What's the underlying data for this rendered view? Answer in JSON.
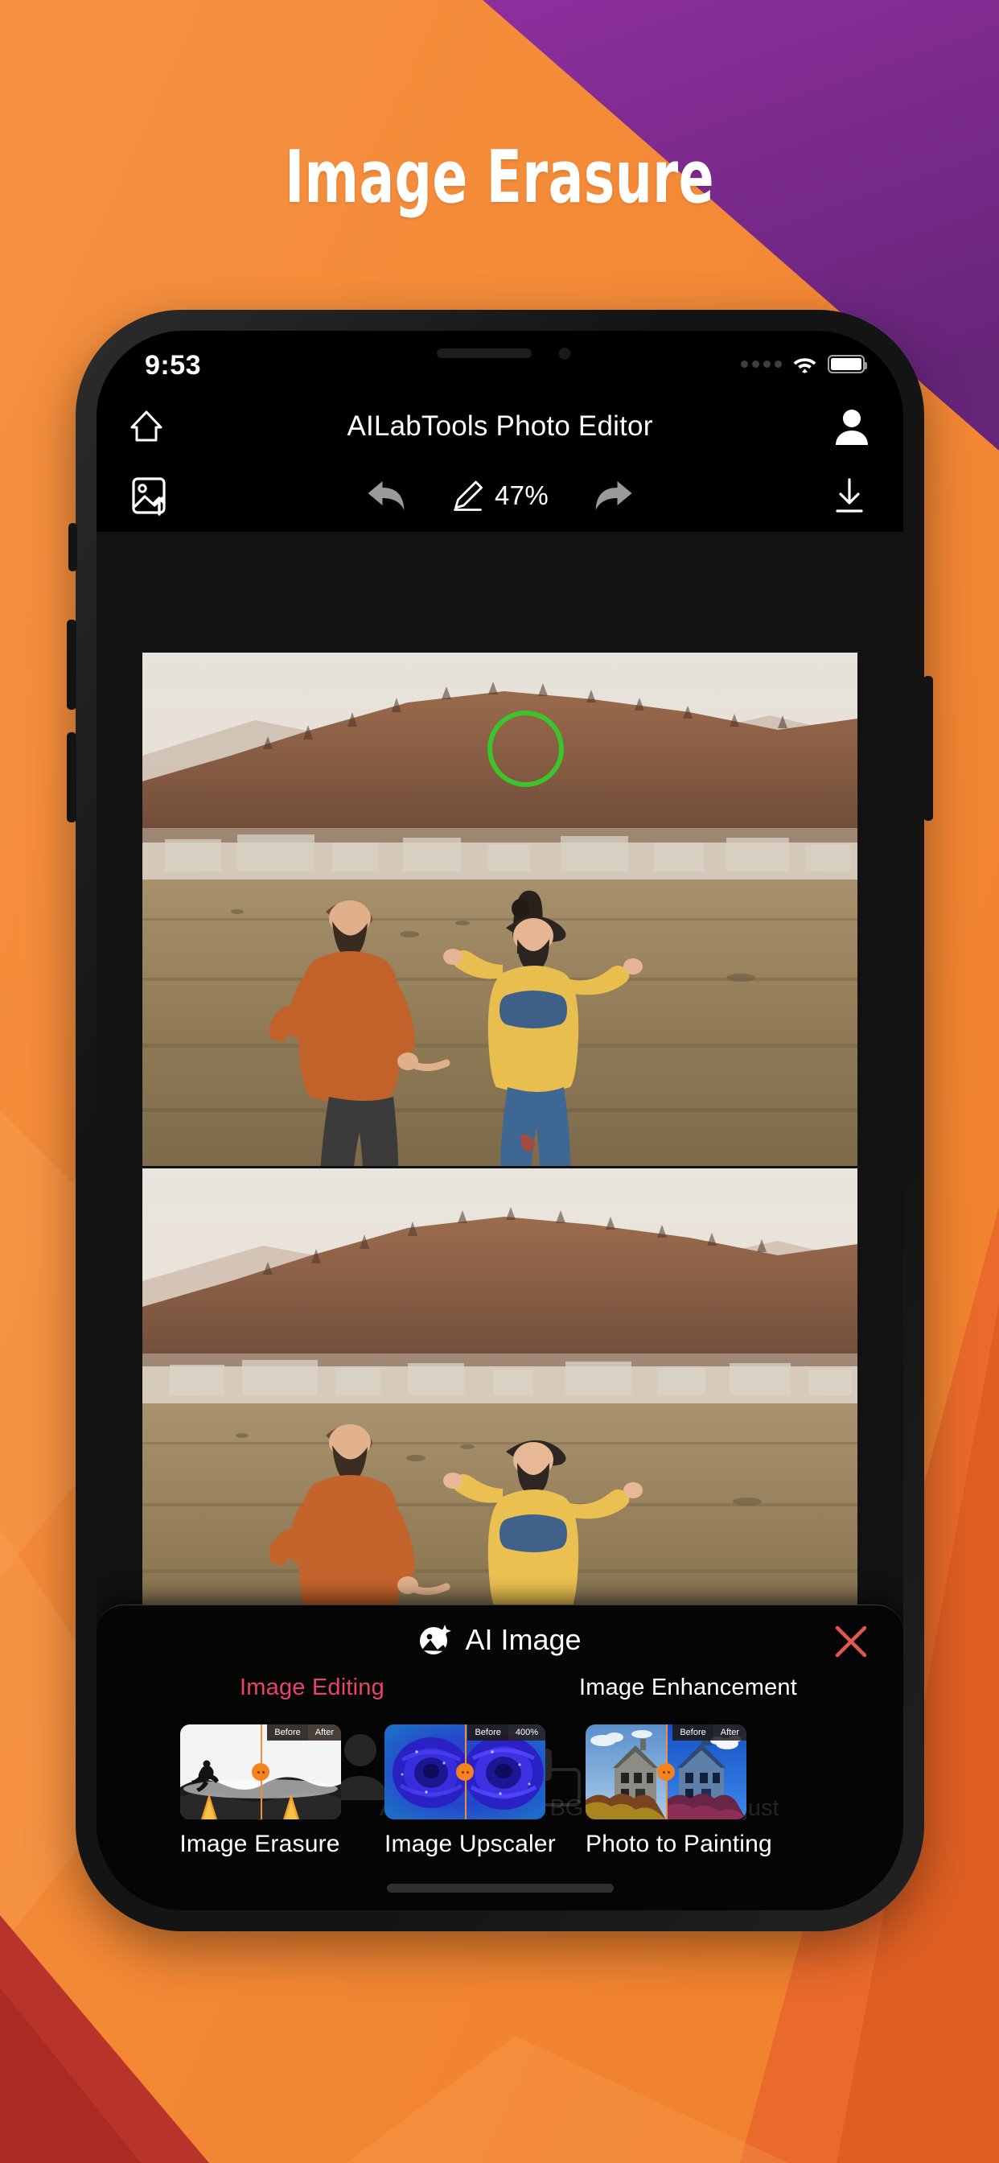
{
  "promo": {
    "headline": "Image Erasure",
    "bg_orange": "#F58C38",
    "bg_orange_dark": "#EE7B2A",
    "bg_purple": "#7B2D8E",
    "bg_red": "#C0392B"
  },
  "status_bar": {
    "time": "9:53",
    "signal_icon": "signal-dots-icon",
    "wifi_icon": "wifi-icon",
    "battery_icon": "battery-full-icon"
  },
  "nav_bar": {
    "home_icon": "home-icon",
    "title": "AILabTools Photo Editor",
    "account_icon": "user-account-icon"
  },
  "toolbar": {
    "upload_icon": "image-upload-icon",
    "undo_icon": "undo-arrow-icon",
    "brush_icon": "brush-size-icon",
    "brush_value": "47%",
    "redo_icon": "redo-arrow-icon",
    "download_icon": "download-icon"
  },
  "canvas": {
    "before_image_alt": "Couple running in a field with a dark dog in the background",
    "after_image_alt": "Same field photo with the dog erased",
    "marker_color": "#3BC42B",
    "arrow_color": "#F5822D"
  },
  "sheet": {
    "title": "AI Image",
    "title_icon": "ai-sparkle-image-icon",
    "close_icon": "close-x-icon",
    "close_color": "#E0584F",
    "tabs": [
      {
        "label": "Image Editing",
        "active": true,
        "color": "#E8446B"
      },
      {
        "label": "Image Enhancement",
        "active": false,
        "color": "#FFFFFF"
      }
    ],
    "ghost_labels": [
      "AI Image",
      "AI Portrait",
      "AI BG Remover",
      "Adjust"
    ],
    "cards": [
      {
        "label": "Image Erasure",
        "thumb_before": "Before",
        "thumb_after": "After",
        "thumb_alt": "Silhouette of a person jumping over a foggy road"
      },
      {
        "label": "Image Upscaler",
        "thumb_before": "Before",
        "thumb_after": "400%",
        "thumb_alt": "Blue rose with water droplets"
      },
      {
        "label": "Photo to Painting",
        "thumb_before": "Before",
        "thumb_after": "After",
        "thumb_alt": "Victorian house with garden turned into a painting"
      }
    ]
  }
}
